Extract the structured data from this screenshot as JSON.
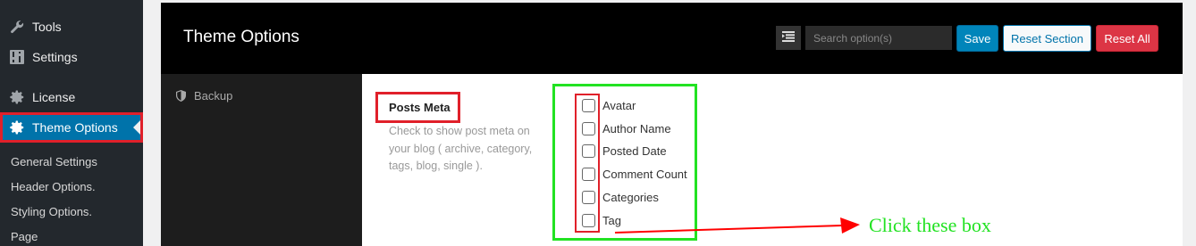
{
  "sidebar": {
    "items": [
      {
        "label": "Tools",
        "icon": "wrench-icon"
      },
      {
        "label": "Settings",
        "icon": "settings-sliders-icon"
      },
      {
        "label": "License",
        "icon": "gear-icon"
      },
      {
        "label": "Theme Options",
        "icon": "gear-icon",
        "active": true
      }
    ],
    "submenu": [
      "General Settings",
      "Header Options.",
      "Styling Options.",
      "Page"
    ]
  },
  "header": {
    "title": "Theme Options",
    "search_placeholder": "Search option(s)",
    "save_label": "Save",
    "reset_section_label": "Reset Section",
    "reset_all_label": "Reset All"
  },
  "nav": {
    "items": [
      {
        "label": "Backup",
        "icon": "shield-icon"
      }
    ]
  },
  "field": {
    "title": "Posts Meta",
    "description": "Check to show post meta on your blog ( archive, category, tags, blog, single ).",
    "options": [
      "Avatar",
      "Author Name",
      "Posted Date",
      "Comment Count",
      "Categories",
      "Tag"
    ]
  },
  "annotation": {
    "text": "Click these box",
    "color": "#22e222",
    "arrow_color": "#ff0000"
  },
  "colors": {
    "sidebar_bg": "#23282d",
    "active_bg": "#0073aa",
    "header_bg": "#000000",
    "highlight_red": "#e0202a",
    "highlight_green": "#22e222"
  }
}
